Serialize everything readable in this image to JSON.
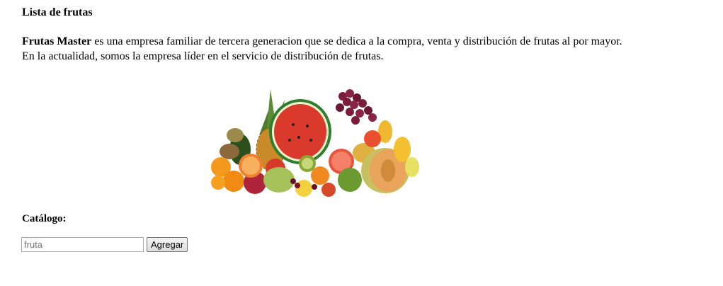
{
  "page": {
    "title": "Lista de frutas",
    "intro": {
      "brand": "Frutas Master",
      "line1_rest": " es una empresa familiar de tercera generacion que se dedica a la compra, venta y distribución de frutas al por mayor.",
      "line2": "En la actualidad, somos la empresa líder en el servicio de distribución de frutas."
    },
    "image": {
      "name": "fruit-assortment-image"
    },
    "catalog": {
      "title": "Catálogo:",
      "input_placeholder": "fruta",
      "input_value": "",
      "add_button_label": "Agregar"
    }
  },
  "colors": {
    "background": "#ffffff",
    "text": "#000000",
    "watermelon": "#d93a2b",
    "melon": "#e9a35a",
    "grape": "#7a1d3a",
    "kiwi": "#8aa836",
    "pineapple": "#c98a2a"
  }
}
